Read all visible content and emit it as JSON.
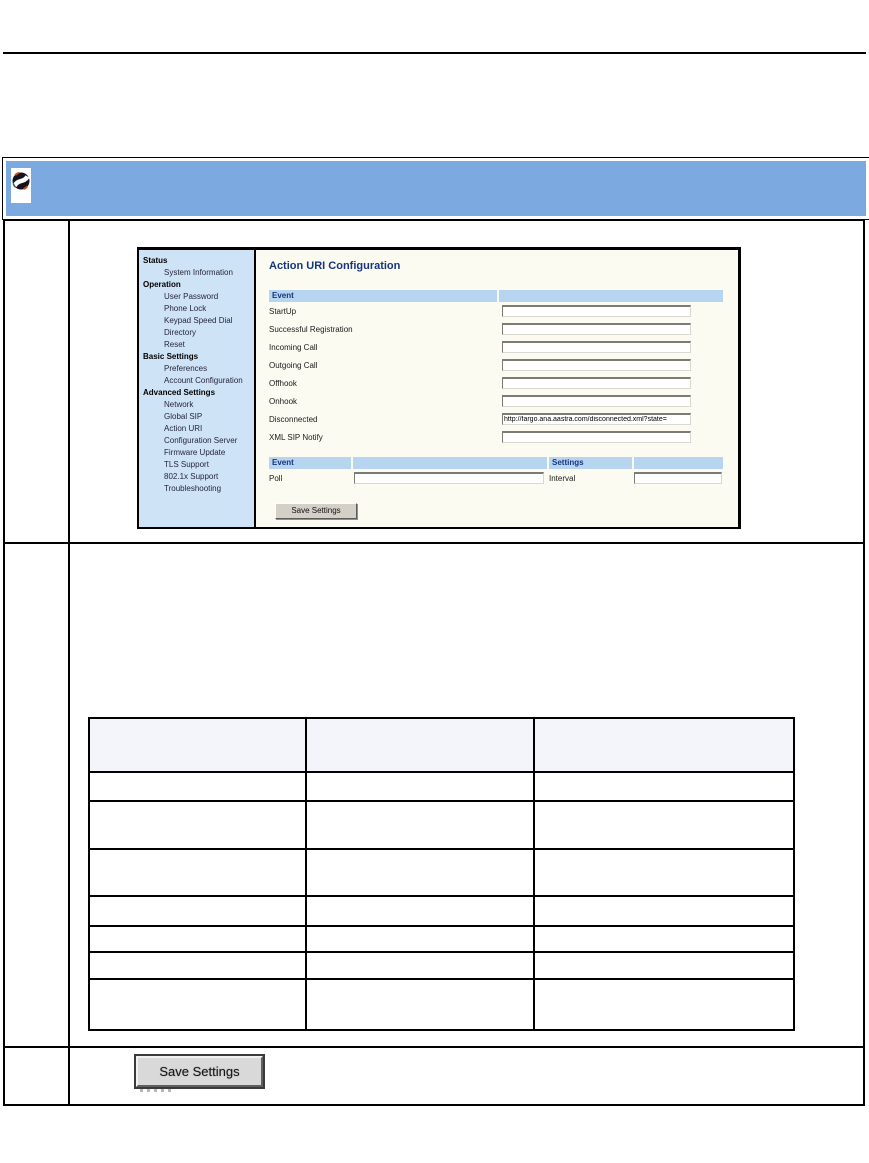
{
  "banner": {
    "icon": "phone-globe-icon"
  },
  "colors": {
    "banner_blue": "#7BA9E0",
    "sidebar_blue": "#CFE3F7",
    "event_bar_blue": "#B7D5F1",
    "heading_navy": "#16357C",
    "panel_background": "#FBFBF2",
    "table_header_lavender": "#F4F4FB",
    "button_gray": "#D4D0C8"
  },
  "webui": {
    "sidebar": {
      "sections": [
        {
          "label": "Status",
          "items": [
            "System Information"
          ]
        },
        {
          "label": "Operation",
          "items": [
            "User Password",
            "Phone Lock",
            "Keypad Speed Dial",
            "Directory",
            "Reset"
          ]
        },
        {
          "label": "Basic Settings",
          "items": [
            "Preferences",
            "Account Configuration"
          ]
        },
        {
          "label": "Advanced Settings",
          "items": [
            "Network",
            "Global SIP",
            "Action URI",
            "Configuration Server",
            "Firmware Update",
            "TLS Support",
            "802.1x Support",
            "Troubleshooting"
          ]
        }
      ]
    },
    "main": {
      "title": "Action URI Configuration",
      "event_table1": {
        "header": "Event",
        "fields": [
          {
            "label": "StartUp",
            "value": ""
          },
          {
            "label": "Successful Registration",
            "value": ""
          },
          {
            "label": "Incoming Call",
            "value": ""
          },
          {
            "label": "Outgoing Call",
            "value": ""
          },
          {
            "label": "Offhook",
            "value": ""
          },
          {
            "label": "Onhook",
            "value": ""
          },
          {
            "label": "Disconnected",
            "value": "http://fargo.ana.aastra.com/disconnected.xml?state="
          },
          {
            "label": "XML SIP Notify",
            "value": ""
          }
        ]
      },
      "event_table2": {
        "event_header": "Event",
        "settings_header": "Settings",
        "poll_label": "Poll",
        "poll_value": "",
        "interval_label": "Interval",
        "interval_value": ""
      },
      "save_button_label": "Save Settings"
    }
  },
  "doc_table": {
    "columns": 3,
    "header_rows": 1,
    "data_rows": 7,
    "cells_text": ""
  },
  "save_image": {
    "label": "Save Settings"
  }
}
